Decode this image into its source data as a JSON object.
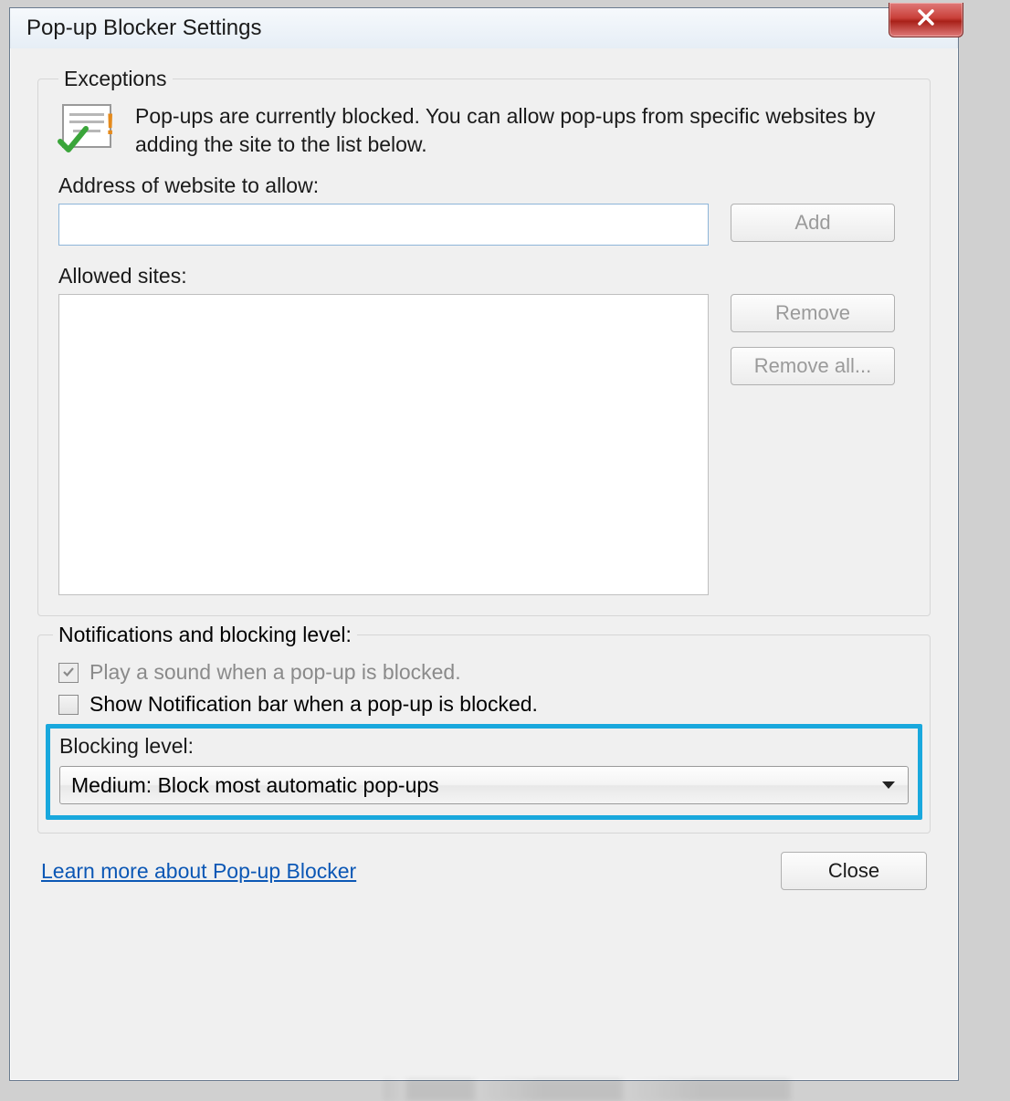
{
  "titlebar": {
    "title": "Pop-up Blocker Settings"
  },
  "exceptions": {
    "legend": "Exceptions",
    "info": "Pop-ups are currently blocked.  You can allow pop-ups from specific websites by adding the site to the list below.",
    "address_label": "Address of website to allow:",
    "address_value": "",
    "add_label": "Add",
    "allowed_label": "Allowed sites:",
    "remove_label": "Remove",
    "remove_all_label": "Remove all..."
  },
  "notifications": {
    "legend": "Notifications and blocking level:",
    "play_sound": "Play a sound when a pop-up is blocked.",
    "play_sound_checked": true,
    "play_sound_disabled": true,
    "show_bar": "Show Notification bar when a pop-up is blocked.",
    "show_bar_checked": false,
    "blocking_label": "Blocking level:",
    "blocking_value": "Medium: Block most automatic pop-ups"
  },
  "footer": {
    "link": "Learn more about Pop-up Blocker",
    "close": "Close"
  }
}
